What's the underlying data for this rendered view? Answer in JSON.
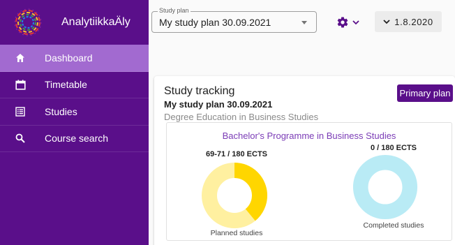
{
  "app": {
    "name": "AnalytiikkaÄly"
  },
  "sidebar": {
    "items": [
      {
        "label": "Dashboard",
        "icon": "home-icon",
        "active": true
      },
      {
        "label": "Timetable",
        "icon": "calendar-icon",
        "active": false
      },
      {
        "label": "Studies",
        "icon": "list-icon",
        "active": false
      },
      {
        "label": "Course search",
        "icon": "search-icon",
        "active": false
      }
    ]
  },
  "topbar": {
    "study_plan_legend": "Study plan",
    "study_plan_value": "My study plan 30.09.2021",
    "version_label": "1.8.2020"
  },
  "card": {
    "title": "Study tracking",
    "plan_name": "My study plan 30.09.2021",
    "degree": "Degree Education in Business Studies",
    "primary_button": "Primary plan",
    "programme": "Bachelor's Programme in Business Studies",
    "planned": {
      "ects": "69-71 / 180 ECTS",
      "caption": "Planned studies",
      "fraction": 0.39
    },
    "completed": {
      "ects": "0 / 180 ECTS",
      "caption": "Completed studies",
      "fraction": 0
    }
  },
  "colors": {
    "sidebar": "#5a0f8a",
    "sidebar_active": "#a26ad0",
    "planned_fill": "#ffd600",
    "planned_track": "#fff0a0",
    "completed_track": "#b9ebf5",
    "programme_text": "#7b3cb6"
  }
}
